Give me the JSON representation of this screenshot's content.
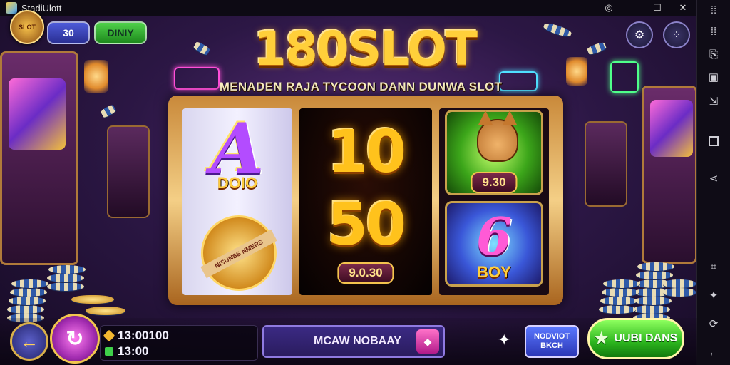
{
  "window": {
    "title": "StadiUlott",
    "controls": {
      "settings": "◎",
      "minimize": "—",
      "maximize": "☐",
      "close": "✕"
    }
  },
  "header": {
    "badge_text": "SLOT",
    "coins_label": "30",
    "daily_label": "DINIY",
    "logo": "180SLOT",
    "subtitle": "MENADEN RAJA TYCOON DANN DUNWA SLOT"
  },
  "reels": {
    "reel1": {
      "top_symbol": "A",
      "top_label": "DOIO",
      "bottom_band": "NISUNSS NMERS"
    },
    "reel2": {
      "top_number": "10",
      "bottom_number": "50",
      "value_tag": "9.0.30"
    },
    "reel3": {
      "top_value": "9.30",
      "bottom_symbol": "6",
      "bottom_label": "BOY"
    }
  },
  "bottom": {
    "back_icon": "←",
    "spin_icon": "↻",
    "balance": "13:00100",
    "win": "13:00",
    "message": "MCAW NOBAAY",
    "mode_line1": "NODVIOT",
    "mode_line2": "BKCH",
    "bet_label": "UUBI DANS"
  },
  "colors": {
    "logo_gold": "#ffcf3a",
    "frame_gold": "#f4cf86",
    "bet_green": "#2cb51e",
    "spin_pink": "#a22cb0",
    "coins_blue": "#2a2f94"
  }
}
